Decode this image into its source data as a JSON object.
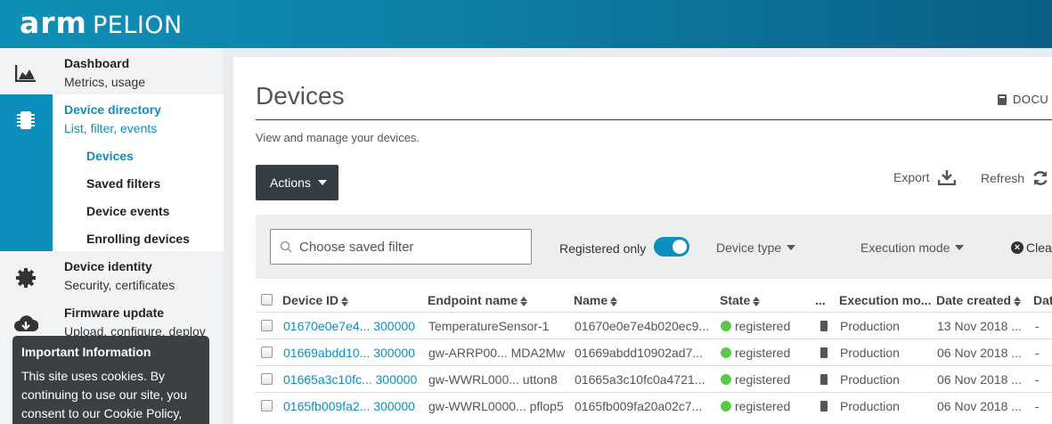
{
  "brand": {
    "logo_arm": "arm",
    "logo_pelion": "PELION",
    "accent": "#0c8fbd"
  },
  "sidebar": {
    "sections": [
      {
        "title": "Dashboard",
        "subtitle": "Metrics, usage",
        "icon": "chart-icon"
      },
      {
        "title": "Device directory",
        "subtitle": "List, filter, events",
        "icon": "chip-icon",
        "children": [
          "Devices",
          "Saved filters",
          "Device events",
          "Enrolling devices"
        ]
      },
      {
        "title": "Device identity",
        "subtitle": "Security, certificates",
        "icon": "gear-icon"
      },
      {
        "title": "Firmware update",
        "subtitle": "Upload, configure, deploy",
        "icon": "cloud-download-icon"
      }
    ]
  },
  "cookie": {
    "title": "Important Information",
    "text": "This site uses cookies. By continuing to use our site, you consent to our Cookie Policy,"
  },
  "page": {
    "title": "Devices",
    "docs_label": "DOCU",
    "description": "View and manage your devices.",
    "actions_label": "Actions",
    "export_label": "Export",
    "refresh_label": "Refresh"
  },
  "filters": {
    "search_placeholder": "Choose saved filter",
    "registered_only_label": "Registered only",
    "registered_only": true,
    "device_type_label": "Device type",
    "execution_mode_label": "Execution mode",
    "clear_label": "Clear"
  },
  "table": {
    "columns": [
      "Device ID",
      "Endpoint name",
      "Name",
      "State",
      "...",
      "Execution mo...",
      "Date created",
      "Dat"
    ],
    "rows": [
      {
        "device_id": "01670e0e7e4... 300000",
        "endpoint": "TemperatureSensor-1",
        "name": "01670e0e7e4b020ec9...",
        "state": "registered",
        "exec": "Production",
        "created": "13 Nov 2018 ...",
        "extra": "-"
      },
      {
        "device_id": "01669abdd10... 300000",
        "endpoint": "gw-ARRP00... MDA2Mw",
        "name": "01669abdd10902ad7...",
        "state": "registered",
        "exec": "Production",
        "created": "06 Nov 2018 ...",
        "extra": "-"
      },
      {
        "device_id": "01665a3c10fc... 300000",
        "endpoint": "gw-WWRL000... utton8",
        "name": "01665a3c10fc0a4721...",
        "state": "registered",
        "exec": "Production",
        "created": "06 Nov 2018 ...",
        "extra": "-"
      },
      {
        "device_id": "0165fb009fa2... 300000",
        "endpoint": "gw-WWRL0000... pflop5",
        "name": "0165fb009fa20a02c7...",
        "state": "registered",
        "exec": "Production",
        "created": "06 Nov 2018 ...",
        "extra": "-"
      }
    ]
  }
}
